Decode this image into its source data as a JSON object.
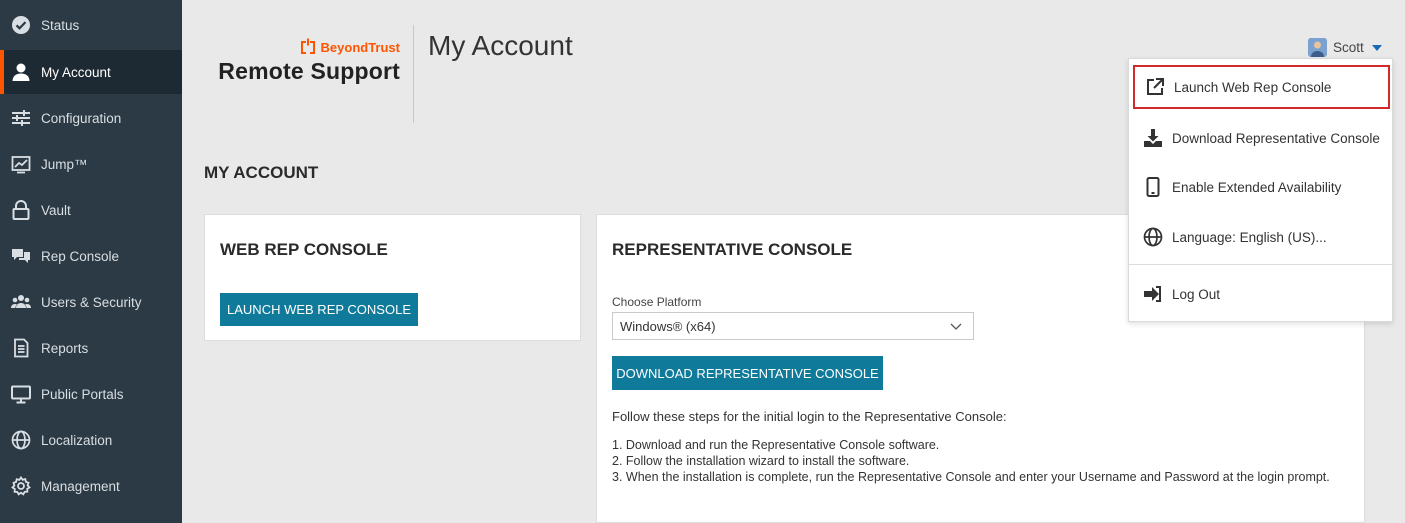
{
  "sidebar": {
    "items": [
      {
        "label": "Status",
        "icon": "check-circle-icon"
      },
      {
        "label": "My Account",
        "icon": "user-icon",
        "active": true
      },
      {
        "label": "Configuration",
        "icon": "sliders-icon"
      },
      {
        "label": "Jump™",
        "icon": "jump-icon"
      },
      {
        "label": "Vault",
        "icon": "lock-icon"
      },
      {
        "label": "Rep Console",
        "icon": "chat-icon"
      },
      {
        "label": "Users & Security",
        "icon": "users-icon"
      },
      {
        "label": "Reports",
        "icon": "report-icon"
      },
      {
        "label": "Public Portals",
        "icon": "monitor-icon"
      },
      {
        "label": "Localization",
        "icon": "globe-icon"
      },
      {
        "label": "Management",
        "icon": "gear-icon"
      }
    ]
  },
  "header": {
    "brand_name": "BeyondTrust",
    "product_name": "Remote Support",
    "page_title": "My Account",
    "user_name": "Scott"
  },
  "main": {
    "section_heading": "MY ACCOUNT",
    "web_rep_card": {
      "title": "WEB REP CONSOLE",
      "button_label": "LAUNCH WEB REP CONSOLE"
    },
    "rep_console_card": {
      "title": "REPRESENTATIVE CONSOLE",
      "platform_label": "Choose Platform",
      "platform_value": "Windows® (x64)",
      "download_label": "DOWNLOAD REPRESENTATIVE CONSOLE",
      "steps_intro": "Follow these steps for the initial login to the Representative Console:",
      "steps": [
        "1. Download and run the Representative Console software.",
        "2. Follow the installation wizard to install the software.",
        "3. When the installation is complete, run the Representative Console and enter your Username and Password at the login prompt."
      ]
    }
  },
  "dropdown": {
    "items": [
      {
        "label": "Launch Web Rep Console",
        "icon": "external-link-icon",
        "highlighted": true
      },
      {
        "label": "Download Representative Console",
        "icon": "download-icon"
      },
      {
        "label": "Enable Extended Availability",
        "icon": "mobile-icon"
      },
      {
        "label": "Language: English (US)...",
        "icon": "globe-icon"
      },
      {
        "label": "Log Out",
        "icon": "logout-icon"
      }
    ]
  },
  "colors": {
    "sidebar_bg": "#2b3a45",
    "sidebar_active_bg": "#1d2a33",
    "accent_orange": "#ff5500",
    "button_teal": "#0f7a9a",
    "highlight_red": "#d12a2a",
    "caret_blue": "#1b6ab8"
  }
}
